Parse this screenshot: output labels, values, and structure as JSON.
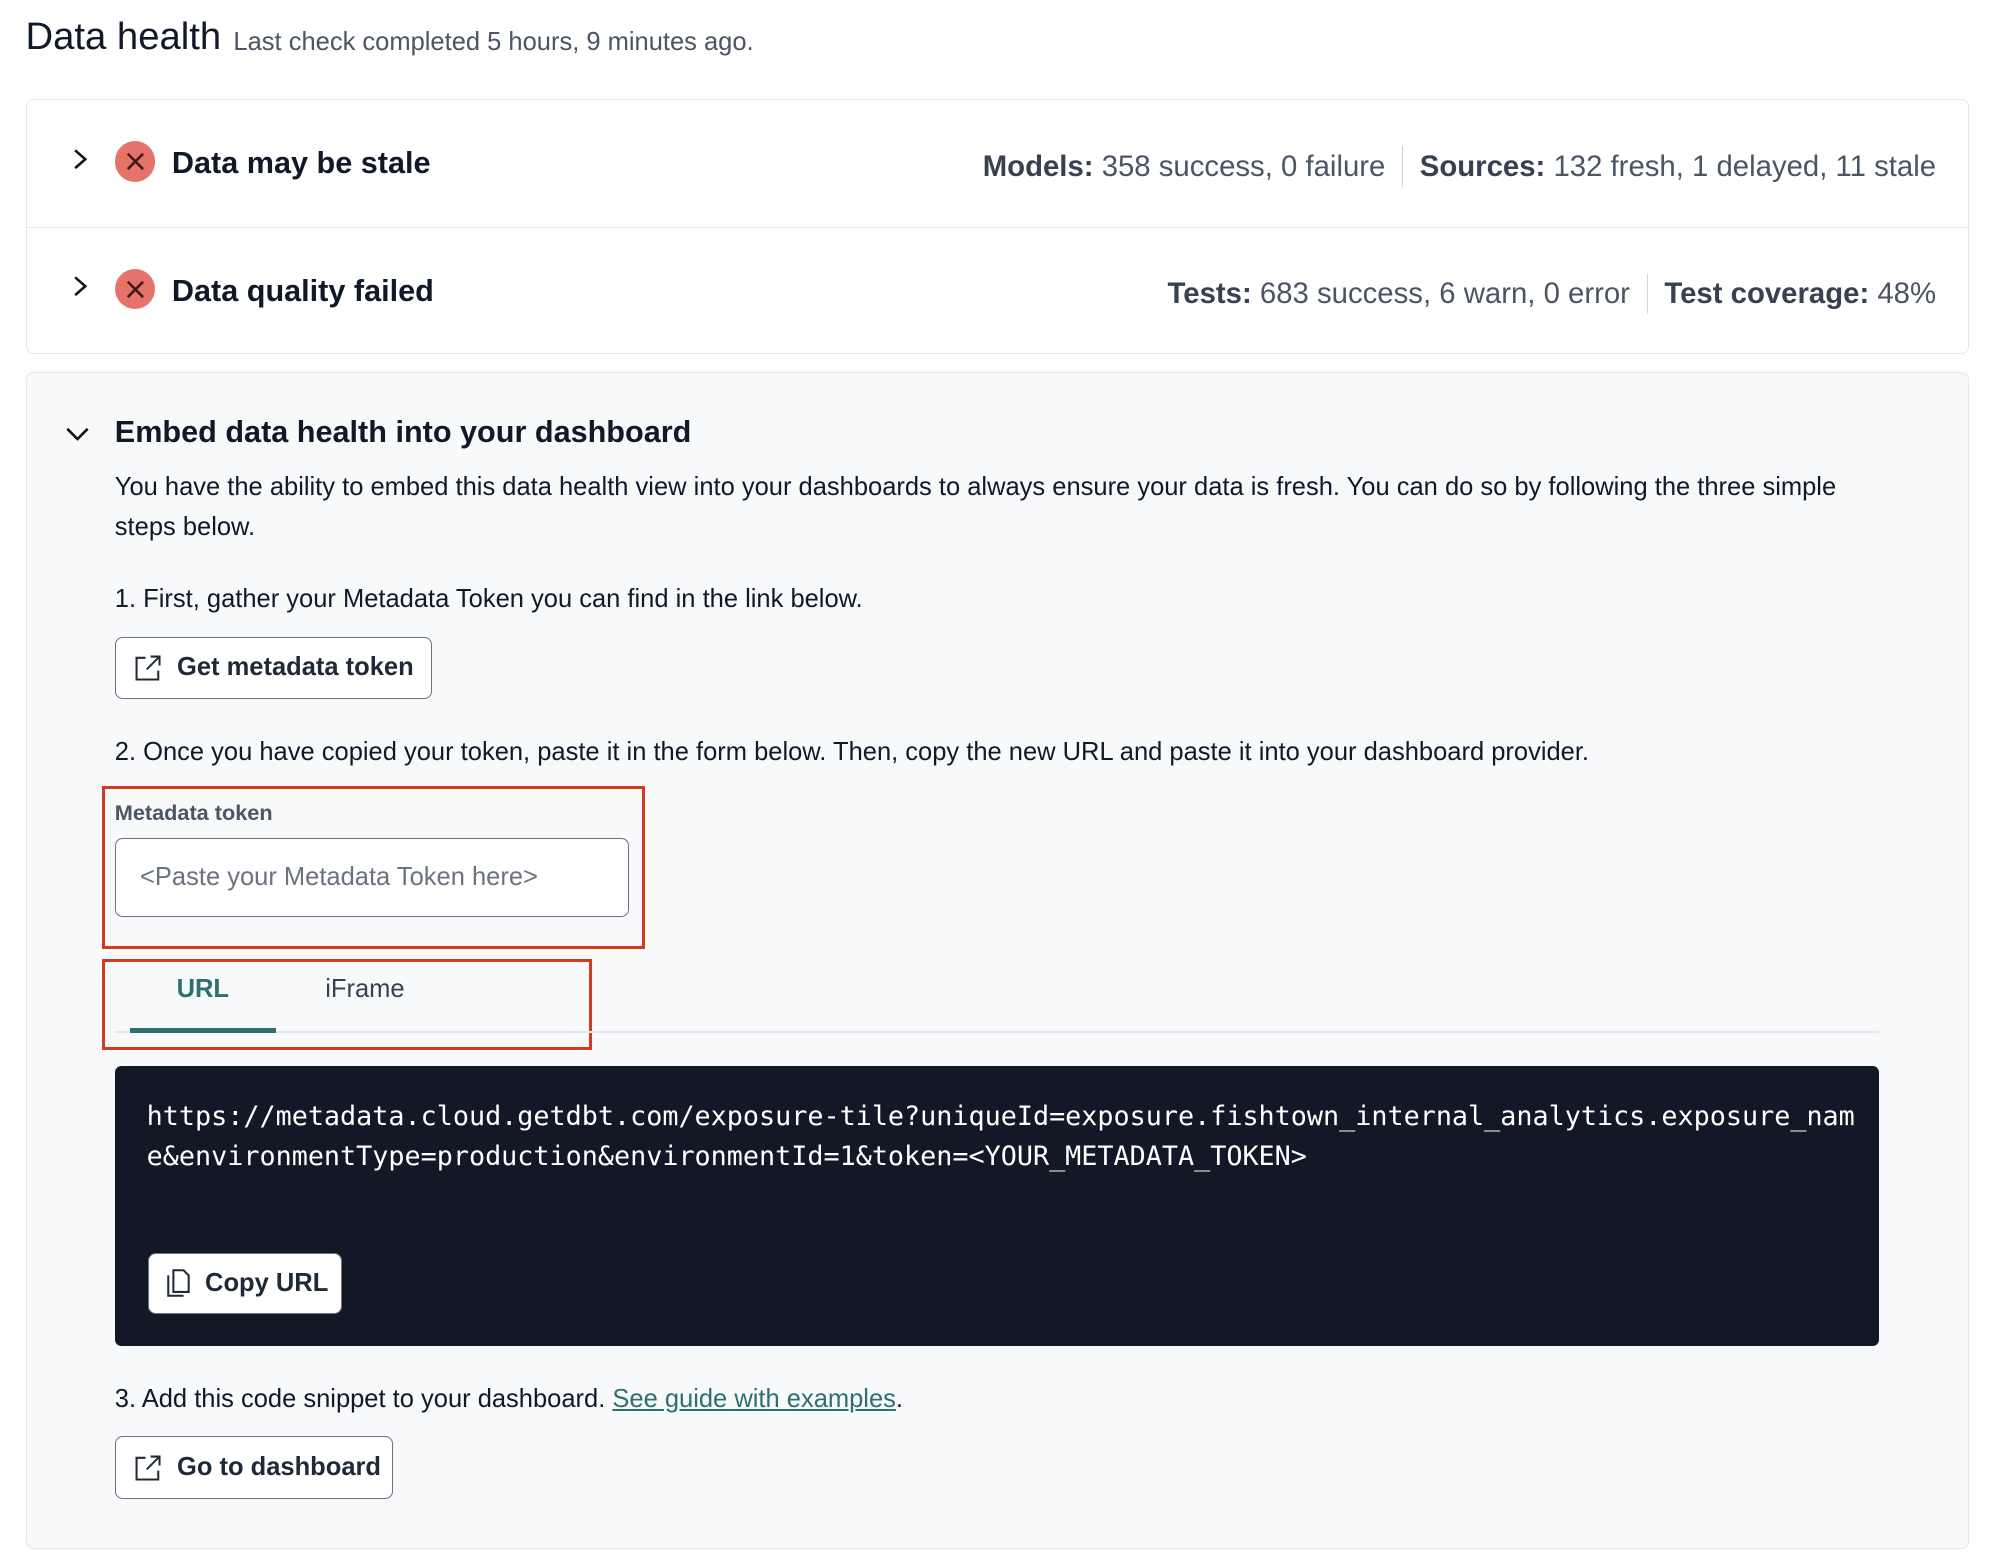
{
  "header": {
    "title": "Data health",
    "subtitle": "Last check completed 5 hours, 9 minutes ago."
  },
  "status_rows": [
    {
      "title": "Data may be stale",
      "icon": "x-circle-icon",
      "stats": [
        {
          "label": "Models:",
          "value": "358 success, 0 failure"
        },
        {
          "label": "Sources:",
          "value": "132 fresh, 1 delayed, 11 stale"
        }
      ]
    },
    {
      "title": "Data quality failed",
      "icon": "x-circle-icon",
      "stats": [
        {
          "label": "Tests:",
          "value": "683 success, 6 warn, 0 error"
        },
        {
          "label": "Test coverage:",
          "value": "48%"
        }
      ]
    }
  ],
  "embed": {
    "heading": "Embed data health into your dashboard",
    "intro": "You have the ability to embed this data health view into your dashboards to always ensure your data is fresh. You can do so by following the three simple steps below.",
    "step1": "1. First, gather your Metadata Token you can find in the link below.",
    "get_token_label": "Get metadata token",
    "step2": "2. Once you have copied your token, paste it in the form below. Then, copy the new URL and paste it into your dashboard provider.",
    "token_label": "Metadata token",
    "token_value": "",
    "token_placeholder": "<Paste your Metadata Token here>",
    "tabs": [
      {
        "label": "URL",
        "active": true
      },
      {
        "label": "iFrame",
        "active": false
      }
    ],
    "code": "https://metadata.cloud.getdbt.com/exposure-tile?uniqueId=exposure.fishtown_internal_analytics.exposure_name&environmentType=production&environmentId=1&token=<YOUR_METADATA_TOKEN>",
    "copy_label": "Copy URL",
    "step3": "3. Add this code snippet to your dashboard. ",
    "guide_link": "See guide with examples",
    "step3_end": ".",
    "dashboard_label": "Go to dashboard"
  },
  "colors": {
    "error": "#e5736a",
    "accent": "#2e6f6f",
    "code_bg": "#131826",
    "highlight": "#d23a22"
  }
}
